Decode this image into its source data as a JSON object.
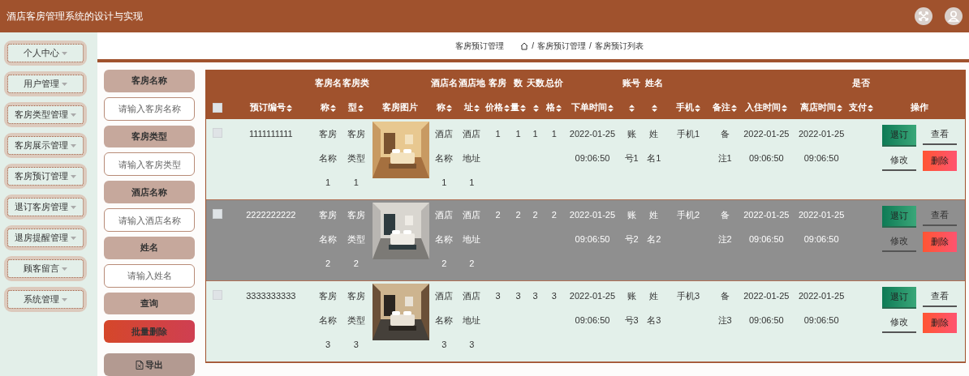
{
  "header": {
    "title": "酒店客房管理系统的设计与实现"
  },
  "sidebar": {
    "items": [
      {
        "label": "个人中心"
      },
      {
        "label": "用户管理"
      },
      {
        "label": "客房类型管理"
      },
      {
        "label": "客房展示管理"
      },
      {
        "label": "客房预订管理"
      },
      {
        "label": "退订客房管理"
      },
      {
        "label": "退房提醒管理"
      },
      {
        "label": "顾客留言"
      },
      {
        "label": "系统管理"
      }
    ]
  },
  "breadcrumb": {
    "page_title": "客房预订管理",
    "trail": [
      {
        "separator": "/",
        "label": "客房预订管理"
      },
      {
        "separator": "/",
        "label": "客房预订列表"
      }
    ]
  },
  "search": {
    "fields": [
      {
        "label": "客房名称",
        "placeholder": "请输入客房名称"
      },
      {
        "label": "客房类型",
        "placeholder": "请输入客房类型"
      },
      {
        "label": "酒店名称",
        "placeholder": "请输入酒店名称"
      },
      {
        "label": "姓名",
        "placeholder": "请输入姓名"
      }
    ],
    "buttons": [
      {
        "label": "查询",
        "kind": "query"
      },
      {
        "label": "批量删除",
        "kind": "danger"
      },
      {
        "label": "导出",
        "kind": "export"
      }
    ]
  },
  "table": {
    "select_all": {
      "checked": false
    },
    "columns": [
      {
        "label": "预订编号",
        "kind": "text",
        "sortable": true
      },
      {
        "label": "客房名称",
        "kind": "text",
        "sortable": true
      },
      {
        "label": "客房类型",
        "kind": "text",
        "sortable": true
      },
      {
        "label": "客房图片",
        "kind": "picture",
        "sortable": false
      },
      {
        "label": "酒店名称",
        "kind": "text",
        "sortable": true
      },
      {
        "label": "酒店地址",
        "kind": "text",
        "sortable": true
      },
      {
        "label": "客房价格",
        "kind": "text",
        "sortable": true
      },
      {
        "label": "数量",
        "kind": "text",
        "sortable": true
      },
      {
        "label": "天数",
        "kind": "text",
        "sortable": true
      },
      {
        "label": "总价格",
        "kind": "text",
        "sortable": true
      },
      {
        "label": "下单时间",
        "kind": "text",
        "sortable": true
      },
      {
        "label": "账号",
        "kind": "text",
        "sortable": true
      },
      {
        "label": "姓名",
        "kind": "text",
        "sortable": true
      },
      {
        "label": "手机",
        "kind": "text",
        "sortable": true
      },
      {
        "label": "备注",
        "kind": "text",
        "sortable": true
      },
      {
        "label": "入住时间",
        "kind": "text",
        "sortable": true
      },
      {
        "label": "离店时间",
        "kind": "text",
        "sortable": true
      },
      {
        "label": "是否支付",
        "kind": "empty",
        "sortable": true
      },
      {
        "label": "操作",
        "kind": "actions",
        "sortable": false
      }
    ],
    "rows": [
      {
        "checked": false,
        "hovered": false,
        "values": [
          "1111111111",
          "客房名称1",
          "客房类型1",
          "酒店名称1",
          "酒店地址1",
          "1",
          "1",
          "1",
          "1",
          "2022-01-25 09:06:50",
          "账号1",
          "姓名1",
          "手机1",
          "备注1",
          "2022-01-25 09:06:50",
          "2022-01-25 09:06:50"
        ],
        "actions": [
          {
            "label": "退订",
            "kind": "primary"
          },
          {
            "label": "查看",
            "kind": "plain"
          },
          {
            "label": "修改",
            "kind": "plain"
          },
          {
            "label": "删除",
            "kind": "danger"
          }
        ]
      },
      {
        "checked": false,
        "hovered": true,
        "values": [
          "2222222222",
          "客房名称2",
          "客房类型2",
          "酒店名称2",
          "酒店地址2",
          "2",
          "2",
          "2",
          "2",
          "2022-01-25 09:06:50",
          "账号2",
          "姓名2",
          "手机2",
          "备注2",
          "2022-01-25 09:06:50",
          "2022-01-25 09:06:50"
        ],
        "actions": [
          {
            "label": "退订",
            "kind": "primary"
          },
          {
            "label": "查看",
            "kind": "plain"
          },
          {
            "label": "修改",
            "kind": "plain"
          },
          {
            "label": "删除",
            "kind": "danger"
          }
        ]
      },
      {
        "checked": false,
        "hovered": false,
        "values": [
          "3333333333",
          "客房名称3",
          "客房类型3",
          "酒店名称3",
          "酒店地址3",
          "3",
          "3",
          "3",
          "3",
          "2022-01-25 09:06:50",
          "账号3",
          "姓名3",
          "手机3",
          "备注3",
          "2022-01-25 09:06:50",
          "2022-01-25 09:06:50"
        ],
        "actions": [
          {
            "label": "退订",
            "kind": "primary"
          },
          {
            "label": "查看",
            "kind": "plain"
          },
          {
            "label": "修改",
            "kind": "plain"
          },
          {
            "label": "删除",
            "kind": "danger"
          }
        ]
      }
    ]
  }
}
